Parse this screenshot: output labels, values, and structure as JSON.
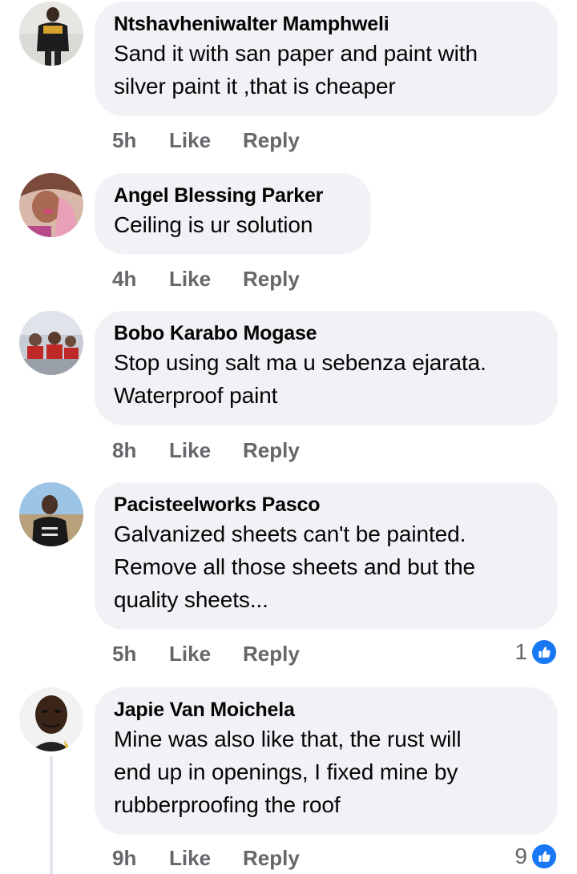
{
  "comments": [
    {
      "author": "Ntshavheniwalter Mamphweli",
      "lines": [
        "Sand it with san paper and paint with",
        "silver paint it ,that is cheaper"
      ],
      "time": "5h",
      "like": "Like",
      "reply": "Reply"
    },
    {
      "author": "Angel Blessing Parker",
      "lines": [
        "Ceiling is ur solution"
      ],
      "time": "4h",
      "like": "Like",
      "reply": "Reply"
    },
    {
      "author": "Bobo Karabo Mogase",
      "lines": [
        "Stop using salt ma u sebenza ejarata.",
        "Waterproof paint"
      ],
      "time": "8h",
      "like": "Like",
      "reply": "Reply"
    },
    {
      "author": "Pacisteelworks Pasco",
      "lines": [
        "Galvanized sheets can't be painted.",
        "Remove all those sheets and but the",
        "quality sheets..."
      ],
      "time": "5h",
      "like": "Like",
      "reply": "Reply",
      "reactions": "1"
    },
    {
      "author": "Japie Van Moichela",
      "lines": [
        "Mine was also like that, the rust will",
        "end up in openings, I fixed mine by",
        "rubberproofing the roof"
      ],
      "time": "9h",
      "like": "Like",
      "reply": "Reply",
      "reactions": "9"
    }
  ],
  "colors": {
    "bubble": "#f0f2f5",
    "meta": "#65676b",
    "like_badge": "#1877f2"
  },
  "icons": {
    "reaction": "thumbs-up-icon"
  }
}
